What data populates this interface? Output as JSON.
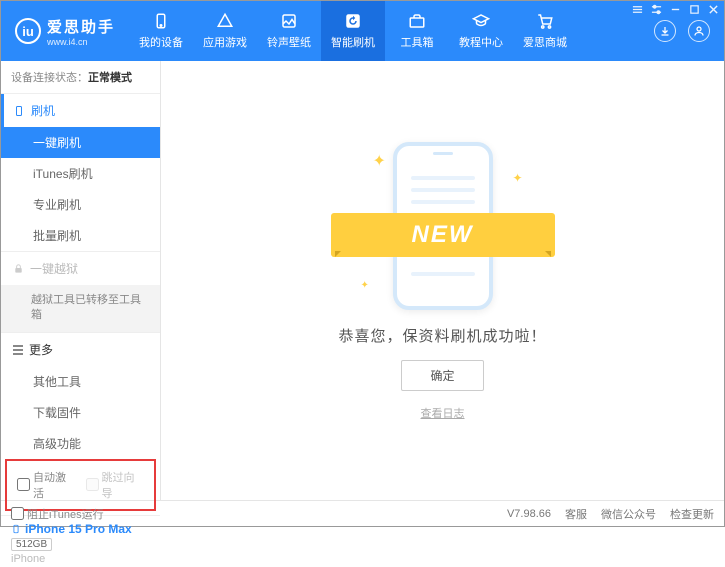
{
  "app": {
    "name": "爱思助手",
    "url": "www.i4.cn"
  },
  "nav": {
    "items": [
      {
        "label": "我的设备"
      },
      {
        "label": "应用游戏"
      },
      {
        "label": "铃声壁纸"
      },
      {
        "label": "智能刷机"
      },
      {
        "label": "工具箱"
      },
      {
        "label": "教程中心"
      },
      {
        "label": "爱思商城"
      }
    ]
  },
  "status": {
    "label": "设备连接状态：",
    "value": "正常模式"
  },
  "sidebar": {
    "flash": {
      "header": "刷机",
      "items": [
        "一键刷机",
        "iTunes刷机",
        "专业刷机",
        "批量刷机"
      ]
    },
    "jailbreak": {
      "header": "一键越狱",
      "note": "越狱工具已转移至工具箱"
    },
    "more": {
      "header": "更多",
      "items": [
        "其他工具",
        "下载固件",
        "高级功能"
      ]
    },
    "checks": {
      "auto_activate": "自动激活",
      "skip_wizard": "跳过向导"
    }
  },
  "device": {
    "name": "iPhone 15 Pro Max",
    "storage": "512GB",
    "type": "iPhone"
  },
  "main": {
    "badge": "NEW",
    "message": "恭喜您，保资料刷机成功啦！",
    "ok": "确定",
    "log": "查看日志"
  },
  "footer": {
    "block_itunes": "阻止iTunes运行",
    "version": "V7.98.66",
    "support": "客服",
    "wechat": "微信公众号",
    "update": "检查更新"
  }
}
